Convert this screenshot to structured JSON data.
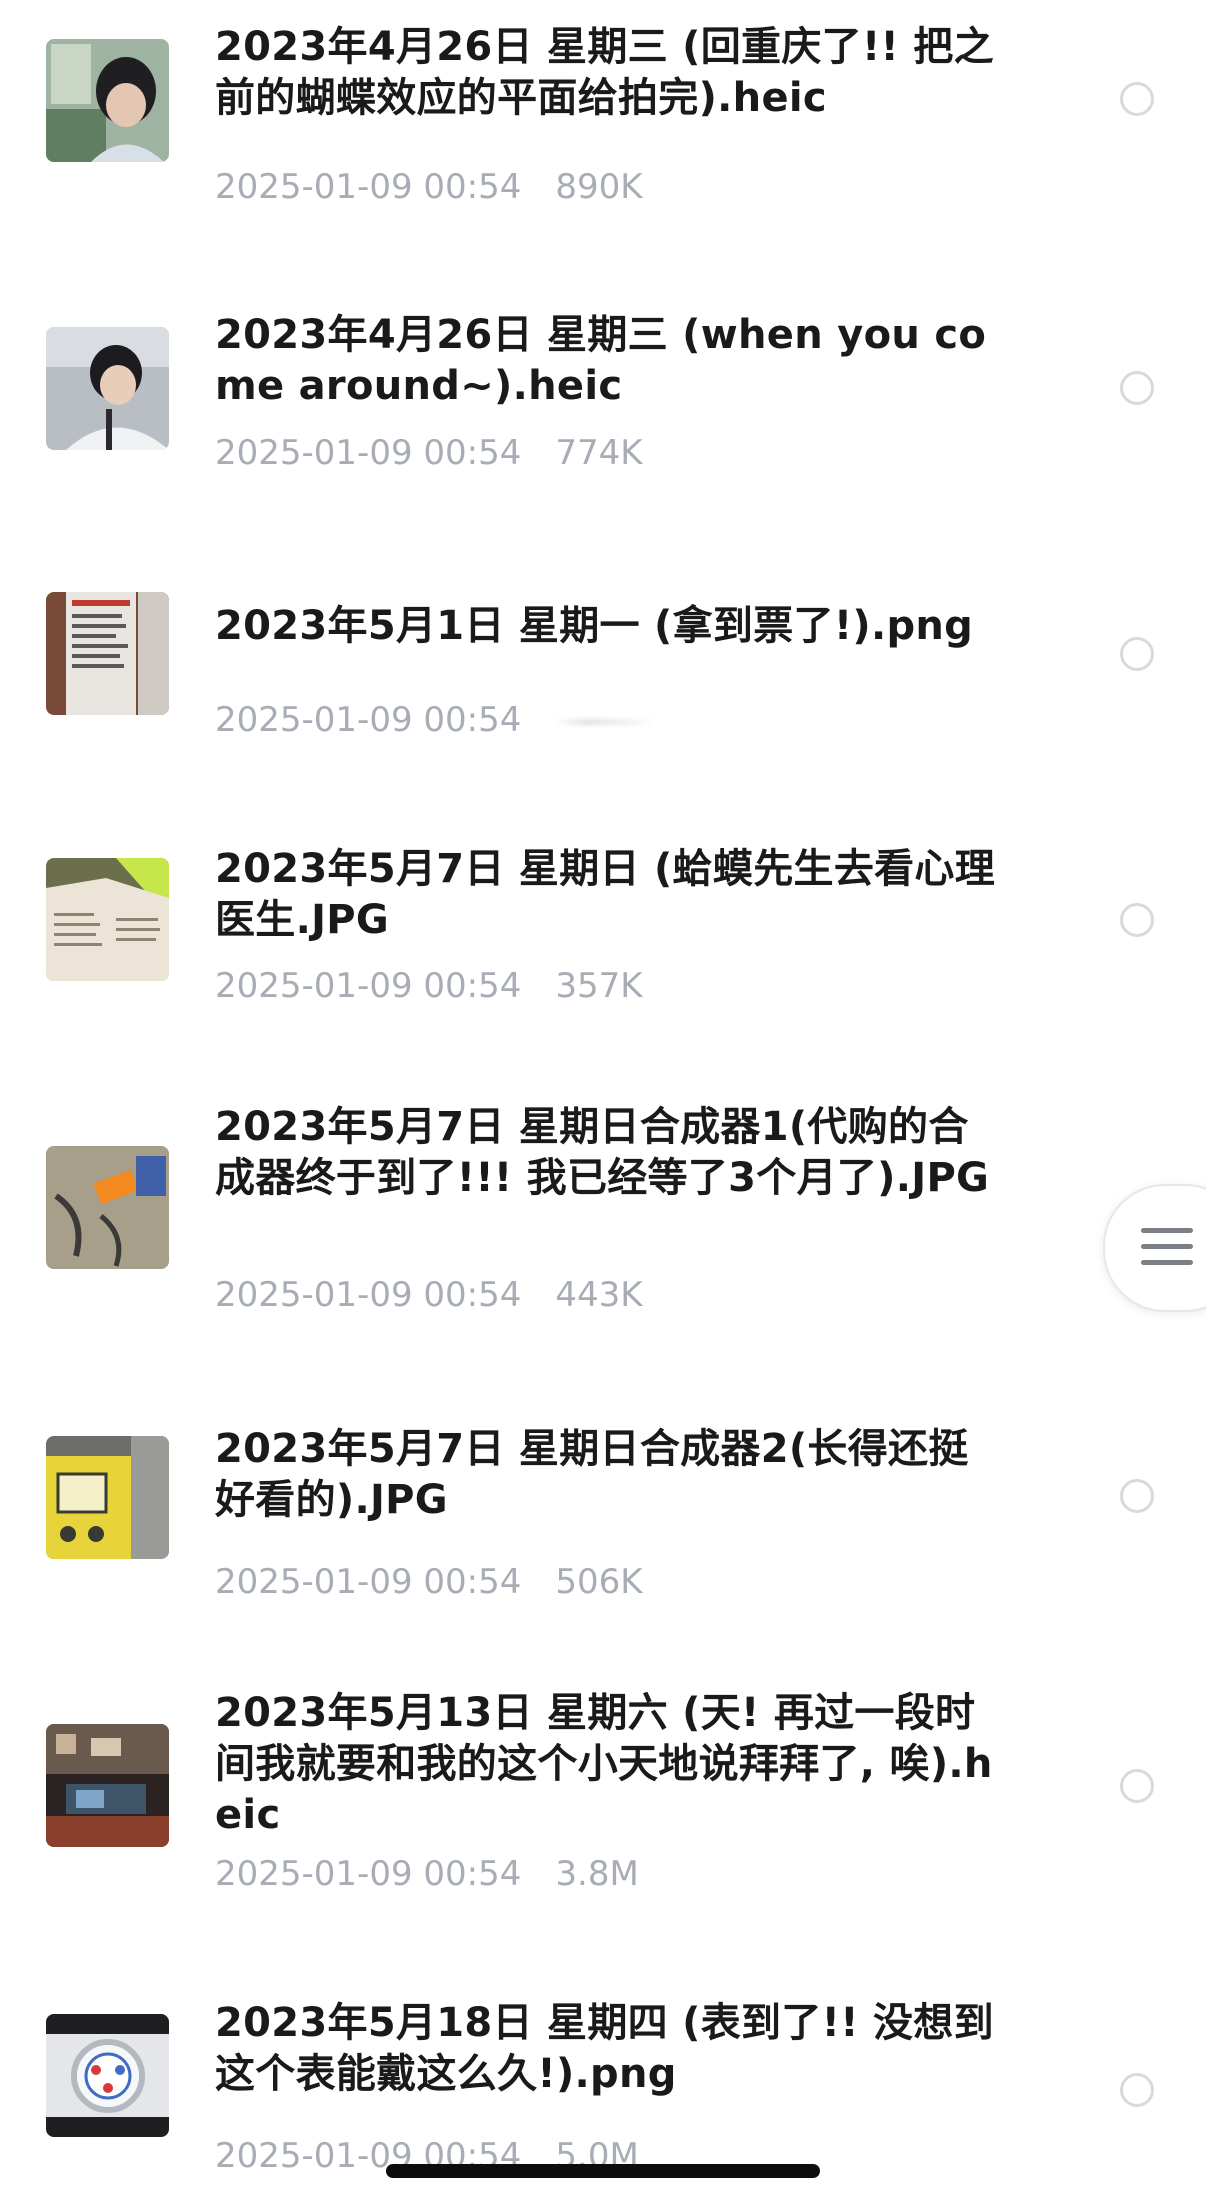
{
  "files": [
    {
      "name": "2023年4月26日 星期三 (回重庆了!! 把之前的蝴蝶效应的平面给拍完).heic",
      "date": "2025-01-09 00:54",
      "size": "890K",
      "thumbnail": "portrait-photo-thumbnail"
    },
    {
      "name": "2023年4月26日 星期三 (when you come around~).heic",
      "date": "2025-01-09 00:54",
      "size": "774K",
      "thumbnail": "portrait-photo-thumbnail"
    },
    {
      "name": "2023年5月1日 星期一 (拿到票了!).png",
      "date": "2025-01-09 00:54",
      "size": "",
      "thumbnail": "ticket-photo-thumbnail"
    },
    {
      "name": "2023年5月7日 星期日 (蛤蟆先生去看心理医生.JPG",
      "date": "2025-01-09 00:54",
      "size": "357K",
      "thumbnail": "book-photo-thumbnail"
    },
    {
      "name": "2023年5月7日 星期日合成器1(代购的合成器终于到了!!! 我已经等了3个月了).JPG",
      "date": "2025-01-09 00:54",
      "size": "443K",
      "thumbnail": "package-photo-thumbnail"
    },
    {
      "name": "2023年5月7日 星期日合成器2(长得还挺好看的).JPG",
      "date": "2025-01-09 00:54",
      "size": "506K",
      "thumbnail": "synthesizer-photo-thumbnail"
    },
    {
      "name": "2023年5月13日 星期六 (天! 再过一段时间我就要和我的这个小天地说拜拜了, 唉).heic",
      "date": "2025-01-09 00:54",
      "size": "3.8M",
      "thumbnail": "room-photo-thumbnail"
    },
    {
      "name": "2023年5月18日 星期四 (表到了!! 没想到这个表能戴这么久!).png",
      "date": "2025-01-09 00:54",
      "size": "5.0M",
      "thumbnail": "watch-photo-thumbnail"
    }
  ],
  "icons": {
    "menu_handle": "hamburger-menu-icon",
    "select": "radio-circle-icon"
  },
  "colors": {
    "title_text": "#1a1a1a",
    "meta_text": "#a7acb5",
    "radio_border": "#d6d9de",
    "background": "#ffffff"
  }
}
